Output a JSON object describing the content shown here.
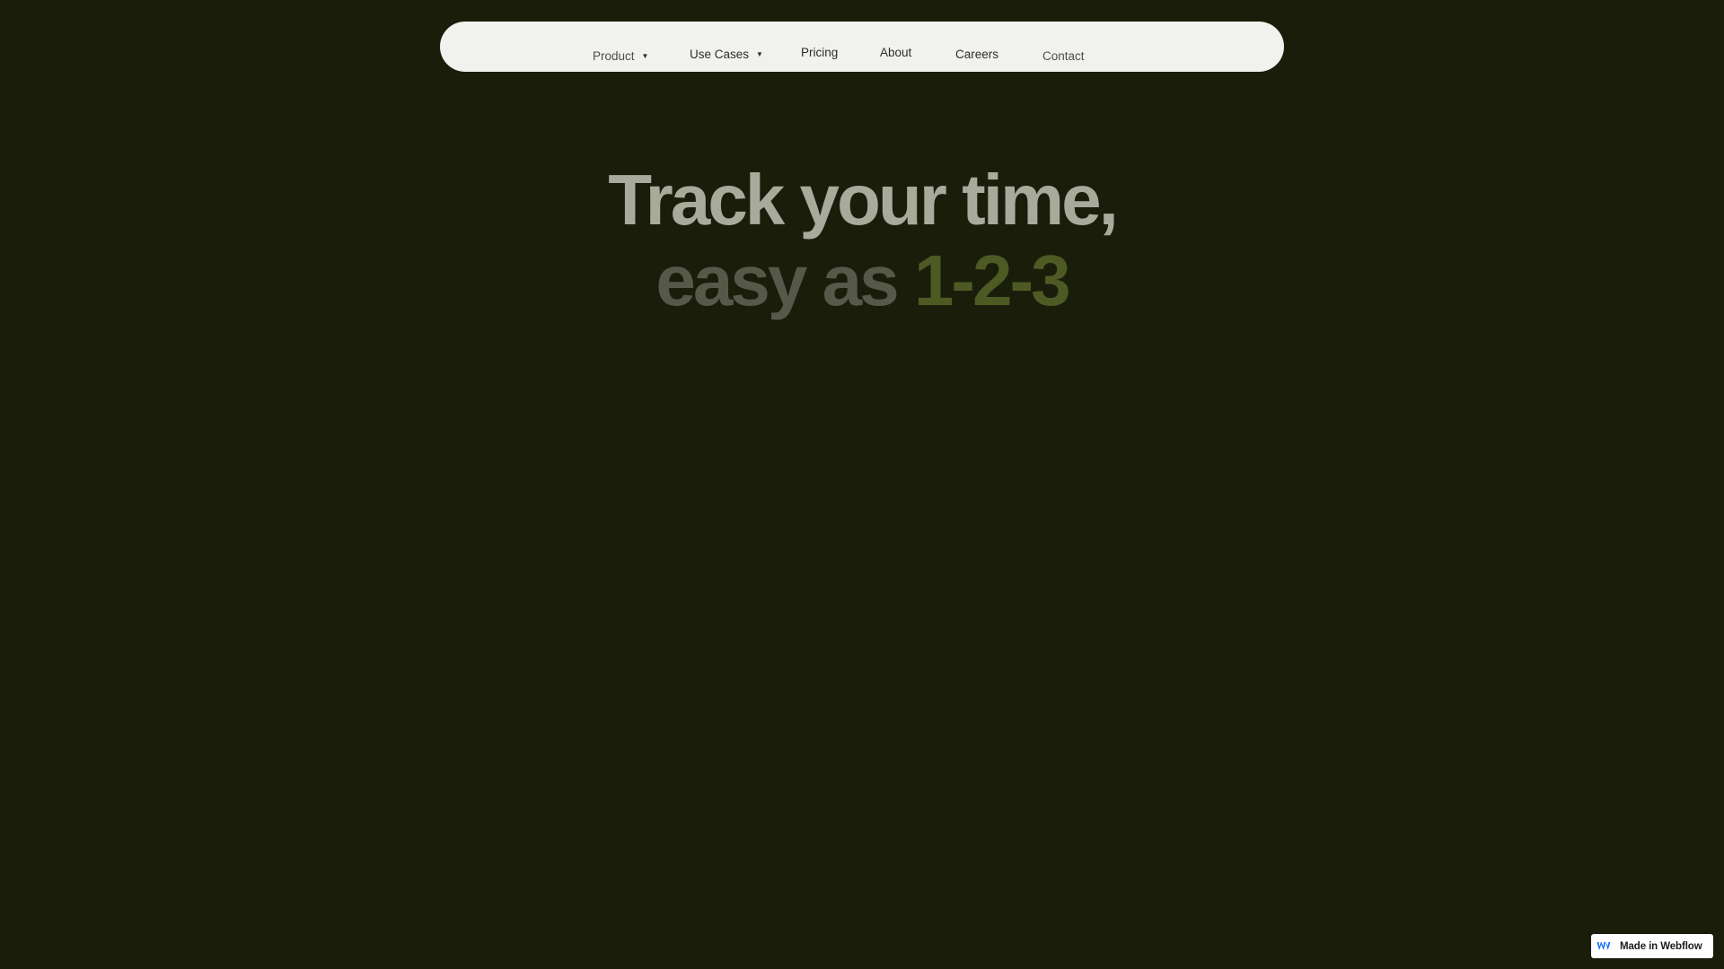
{
  "nav": {
    "items": [
      {
        "label": "Product",
        "has_dropdown": true
      },
      {
        "label": "Use Cases",
        "has_dropdown": true
      },
      {
        "label": "Pricing",
        "has_dropdown": false
      },
      {
        "label": "About",
        "has_dropdown": false
      },
      {
        "label": "Careers",
        "has_dropdown": false
      },
      {
        "label": "Contact",
        "has_dropdown": false
      }
    ],
    "caret_icon": "▼"
  },
  "hero": {
    "line1": "Track your time,",
    "line2_prefix": "easy as ",
    "line2_accent": "1-2-3"
  },
  "badge": {
    "label": "Made in Webflow",
    "icon": "webflow-logo-icon"
  },
  "colors": {
    "background": "#1b1d0b",
    "navbar": "#f1f2ee",
    "hero_primary": "#a8aa9c",
    "hero_secondary": "#56584a",
    "hero_accent": "#4e5a24",
    "webflow_blue": "#146ef5"
  }
}
